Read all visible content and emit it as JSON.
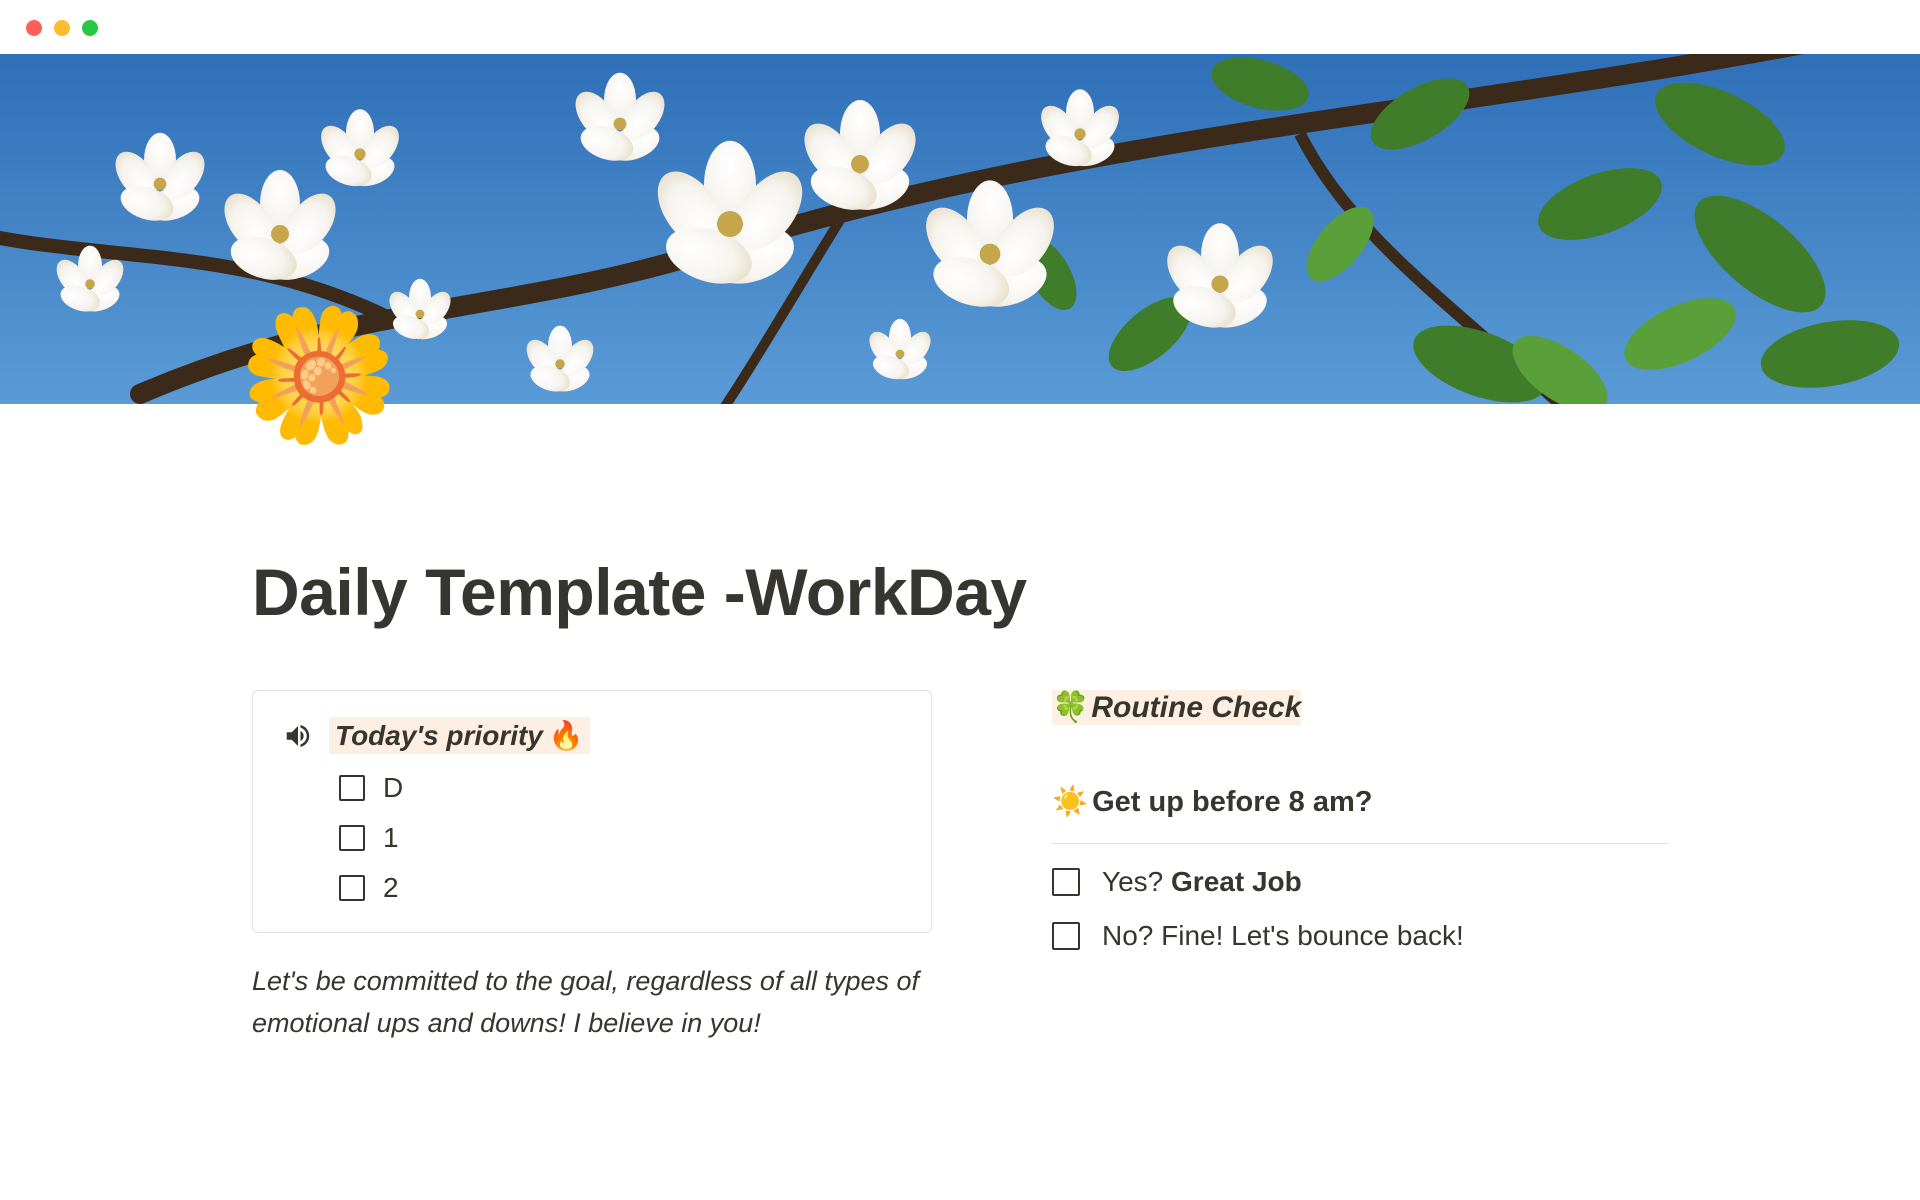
{
  "page_icon": "🌼",
  "title": "Daily Template -WorkDay",
  "priority": {
    "heading": "Today's priority",
    "heading_emoji": "🔥",
    "items": [
      {
        "label": "D"
      },
      {
        "label": "1"
      },
      {
        "label": "2"
      }
    ]
  },
  "quote": "Let's be committed to the goal, regardless of all types of emotional ups and downs! I believe in you!",
  "routine": {
    "heading_emoji": "🍀",
    "heading": "Routine Check",
    "question_emoji": "☀️",
    "question": "Get up before 8 am?",
    "answers": [
      {
        "prefix": "Yes? ",
        "strong": "Great Job"
      },
      {
        "prefix": "No? Fine! Let's bounce back!",
        "strong": ""
      }
    ]
  }
}
